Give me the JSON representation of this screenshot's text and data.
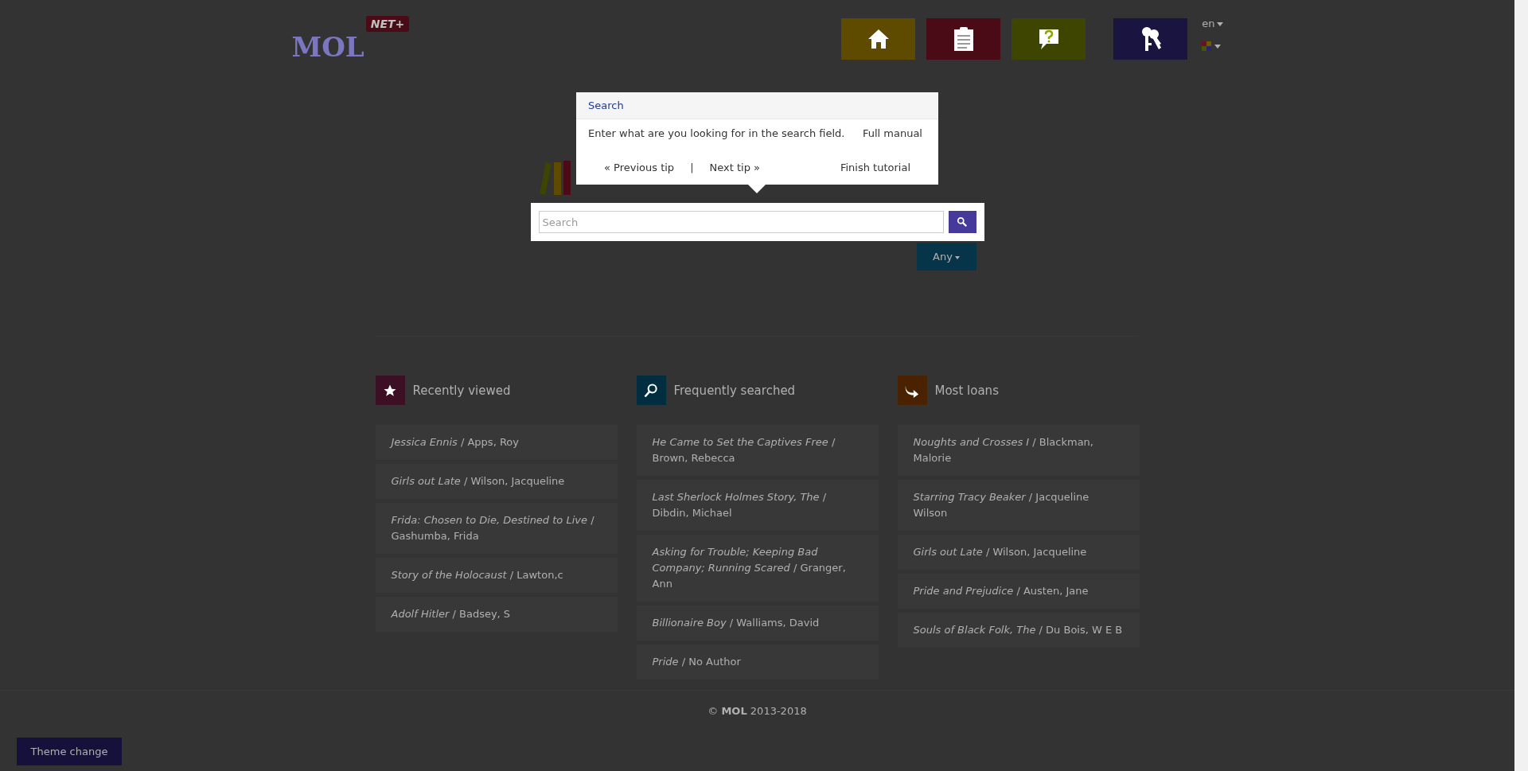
{
  "header": {
    "logo": {
      "name": "MOL",
      "badge": "NET+"
    },
    "nav_buttons": [
      {
        "kind": "home",
        "color": "#5e4b00"
      },
      {
        "kind": "clipboard",
        "color": "#4a0a16"
      },
      {
        "kind": "help",
        "color": "#3d4500"
      },
      {
        "kind": "keys",
        "color": "#1a1540"
      }
    ],
    "language": "en"
  },
  "tutorial_popup": {
    "title": "Search",
    "message": "Enter what are you looking for in the search field.",
    "full_manual": "Full manual",
    "previous": "« Previous tip",
    "separator": "|",
    "next": "Next tip »",
    "finish": "Finish tutorial"
  },
  "search": {
    "placeholder": "Search"
  },
  "filter": {
    "label": "Any"
  },
  "sections": [
    {
      "kind": "recent",
      "title": "Recently viewed",
      "color": "#3d0f24",
      "items": [
        "*Jessica Ennis* / Apps, Roy",
        "*Girls out Late* / Wilson, Jacqueline",
        "*Frida: Chosen to Die, Destined to Live* / Gashumba, Frida",
        "*Story of the Holocaust* / Lawton,c",
        "*Adolf Hitler* / Badsey, S"
      ]
    },
    {
      "kind": "searched",
      "title": "Frequently searched",
      "color": "#002e40",
      "items": [
        "*He Came to Set the Captives Free* / Brown, Rebecca",
        "*Last Sherlock Holmes Story, The* / Dibdin, Michael",
        "*Asking for Trouble; Keeping Bad Company; Running Scared* / Granger, Ann",
        "*Billionaire Boy* / Walliams, David",
        "*Pride* / No Author"
      ]
    },
    {
      "kind": "loans",
      "title": "Most loans",
      "color": "#4a2200",
      "items": [
        "*Noughts and Crosses I* / Blackman, Malorie",
        "*Starring Tracy Beaker* / Jacqueline Wilson",
        "*Girls out Late* / Wilson, Jacqueline",
        "*Pride and Prejudice* / Austen, Jane",
        "*Souls of Black Folk, The* / Du Bois, W E B"
      ]
    }
  ],
  "footer": {
    "copyright": "© **MOL** 2013-2018"
  },
  "theme_button": "Theme change"
}
